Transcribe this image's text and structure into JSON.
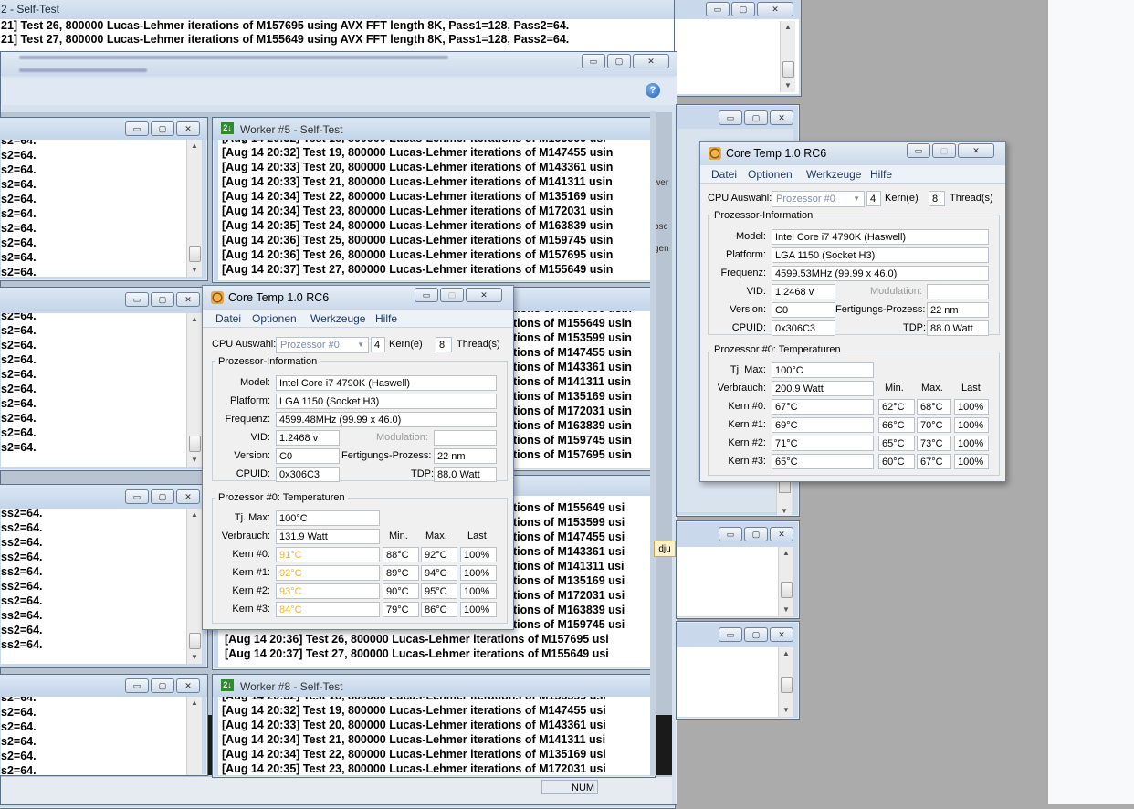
{
  "main_window": {
    "title": "2 - Self-Test",
    "lines": [
      "21] Test 26, 800000 Lucas-Lehmer iterations of M157695 using AVX FFT length 8K, Pass1=128, Pass2=64.",
      "21] Test 27, 800000 Lucas-Lehmer iterations of M155649 using AVX FFT length 8K, Pass1=128, Pass2=64."
    ],
    "status_num": "NUM",
    "help_icon": "help-icon"
  },
  "left_workers": {
    "w1": [
      "s2=64.",
      "s2=64.",
      "s2=64.",
      "s2=64.",
      "s2=64.",
      "s2=64.",
      "s2=64.",
      "s2=64.",
      "s2=64.",
      "s2=64."
    ],
    "w2": [
      "s2=64.",
      "s2=64.",
      "s2=64.",
      "s2=64.",
      "s2=64.",
      "s2=64.",
      "s2=64.",
      "s2=64.",
      "s2=64.",
      "s2=64."
    ],
    "w3": [
      "ss2=64.",
      "ss2=64.",
      "ss2=64.",
      "ss2=64.",
      "ss2=64.",
      "ss2=64.",
      "ss2=64.",
      "ss2=64.",
      "ss2=64.",
      "ss2=64."
    ],
    "w4": [
      "s2=64.",
      "s2=64.",
      "s2=64.",
      "s2=64.",
      "s2=64.",
      "s2=64."
    ]
  },
  "worker5": {
    "title": "Worker #5 - Self-Test",
    "lines": [
      "[Aug 14 20:32] Test 19, 800000 Lucas-Lehmer iterations of M147455 usin",
      "[Aug 14 20:33] Test 20, 800000 Lucas-Lehmer iterations of M143361 usin",
      "[Aug 14 20:33] Test 21, 800000 Lucas-Lehmer iterations of M141311 usin",
      "[Aug 14 20:34] Test 22, 800000 Lucas-Lehmer iterations of M135169 usin",
      "[Aug 14 20:34] Test 23, 800000 Lucas-Lehmer iterations of M172031 usin",
      "[Aug 14 20:35] Test 24, 800000 Lucas-Lehmer iterations of M163839 usin",
      "[Aug 14 20:36] Test 25, 800000 Lucas-Lehmer iterations of M159745 usin",
      "[Aug 14 20:36] Test 26, 800000 Lucas-Lehmer iterations of M157695 usin",
      "[Aug 14 20:37] Test 27, 800000 Lucas-Lehmer iterations of M155649 usin"
    ],
    "side_bits": [
      "wer",
      "bsc",
      "gen"
    ]
  },
  "worker6": {
    "lines": [
      "ations of M155649 usin",
      "ations of M153599 usin",
      "ations of M147455 usin",
      "ations of M143361 usin",
      "ations of M141311 usin",
      "ations of M135169 usin",
      "ations of M172031 usin",
      "ations of M163839 usin",
      "ations of M159745 usin",
      "ations of M157695 usin"
    ]
  },
  "worker7": {
    "lines": [
      "ations of M153599 usi",
      "ations of M147455 usi",
      "ations of M143361 usi",
      "ations of M141311 usi",
      "ations of M135169 usi",
      "ations of M172031 usi",
      "ations of M163839 usi",
      "ations of M159745 usi",
      "[Aug 14 20:36] Test 26, 800000 Lucas-Lehmer iterations of M157695 usi",
      "[Aug 14 20:37] Test 27, 800000 Lucas-Lehmer iterations of M155649 usi"
    ],
    "side_bit": "dju"
  },
  "worker8": {
    "title": "Worker #8 - Self-Test",
    "lines": [
      "[Aug 14 20:32] Test 19, 800000 Lucas-Lehmer iterations of M147455 usi",
      "[Aug 14 20:33] Test 20, 800000 Lucas-Lehmer iterations of M143361 usi",
      "[Aug 14 20:34] Test 21, 800000 Lucas-Lehmer iterations of M141311 usi",
      "[Aug 14 20:34] Test 22, 800000 Lucas-Lehmer iterations of M135169 usi"
    ]
  },
  "coretemp_a": {
    "title": "Core Temp 1.0 RC6",
    "menu": [
      "Datei",
      "Optionen",
      "Werkzeuge",
      "Hilfe"
    ],
    "cpu_label": "CPU Auswahl:",
    "cpu_value": "Prozessor #0",
    "cores": "4",
    "cores_label": "Kern(e)",
    "threads": "8",
    "threads_label": "Thread(s)",
    "info_group": "Prozessor-Information",
    "model_label": "Model:",
    "model": "Intel Core i7 4790K (Haswell)",
    "platform_label": "Platform:",
    "platform": "LGA 1150 (Socket H3)",
    "freq_label": "Frequenz:",
    "freq": "4599.48MHz (99.99 x 46.0)",
    "vid_label": "VID:",
    "vid": "1.2468 v",
    "modulation_label": "Modulation:",
    "version_label": "Version:",
    "version": "C0",
    "process_label": "Fertigungs-Prozess:",
    "process": "22 nm",
    "cpuid_label": "CPUID:",
    "cpuid": "0x306C3",
    "tdp_label": "TDP:",
    "tdp": "88.0 Watt",
    "temp_group": "Prozessor #0: Temperaturen",
    "tjmax_label": "Tj. Max:",
    "tjmax": "100°C",
    "power_label": "Verbrauch:",
    "power": "131.9 Watt",
    "col_min": "Min.",
    "col_max": "Max.",
    "col_last": "Last",
    "cores_rows": [
      {
        "label": "Kern #0:",
        "temp": "91°C",
        "min": "88°C",
        "max": "92°C",
        "load": "100%"
      },
      {
        "label": "Kern #1:",
        "temp": "92°C",
        "min": "89°C",
        "max": "94°C",
        "load": "100%"
      },
      {
        "label": "Kern #2:",
        "temp": "93°C",
        "min": "90°C",
        "max": "95°C",
        "load": "100%"
      },
      {
        "label": "Kern #3:",
        "temp": "84°C",
        "min": "79°C",
        "max": "86°C",
        "load": "100%"
      }
    ]
  },
  "coretemp_b": {
    "title": "Core Temp 1.0 RC6",
    "menu": [
      "Datei",
      "Optionen",
      "Werkzeuge",
      "Hilfe"
    ],
    "cpu_label": "CPU Auswahl:",
    "cpu_value": "Prozessor #0",
    "cores": "4",
    "cores_label": "Kern(e)",
    "threads": "8",
    "threads_label": "Thread(s)",
    "info_group": "Prozessor-Information",
    "model_label": "Model:",
    "model": "Intel Core i7 4790K (Haswell)",
    "platform_label": "Platform:",
    "platform": "LGA 1150 (Socket H3)",
    "freq_label": "Frequenz:",
    "freq": "4599.53MHz (99.99 x 46.0)",
    "vid_label": "VID:",
    "vid": "1.2468 v",
    "modulation_label": "Modulation:",
    "version_label": "Version:",
    "version": "C0",
    "process_label": "Fertigungs-Prozess:",
    "process": "22 nm",
    "cpuid_label": "CPUID:",
    "cpuid": "0x306C3",
    "tdp_label": "TDP:",
    "tdp": "88.0 Watt",
    "temp_group": "Prozessor #0: Temperaturen",
    "tjmax_label": "Tj. Max:",
    "tjmax": "100°C",
    "power_label": "Verbrauch:",
    "power": "200.9 Watt",
    "col_min": "Min.",
    "col_max": "Max.",
    "col_last": "Last",
    "cores_rows": [
      {
        "label": "Kern #0:",
        "temp": "67°C",
        "min": "62°C",
        "max": "68°C",
        "load": "100%"
      },
      {
        "label": "Kern #1:",
        "temp": "69°C",
        "min": "66°C",
        "max": "70°C",
        "load": "100%"
      },
      {
        "label": "Kern #2:",
        "temp": "71°C",
        "min": "65°C",
        "max": "73°C",
        "load": "100%"
      },
      {
        "label": "Kern #3:",
        "temp": "65°C",
        "min": "60°C",
        "max": "67°C",
        "load": "100%"
      }
    ]
  }
}
